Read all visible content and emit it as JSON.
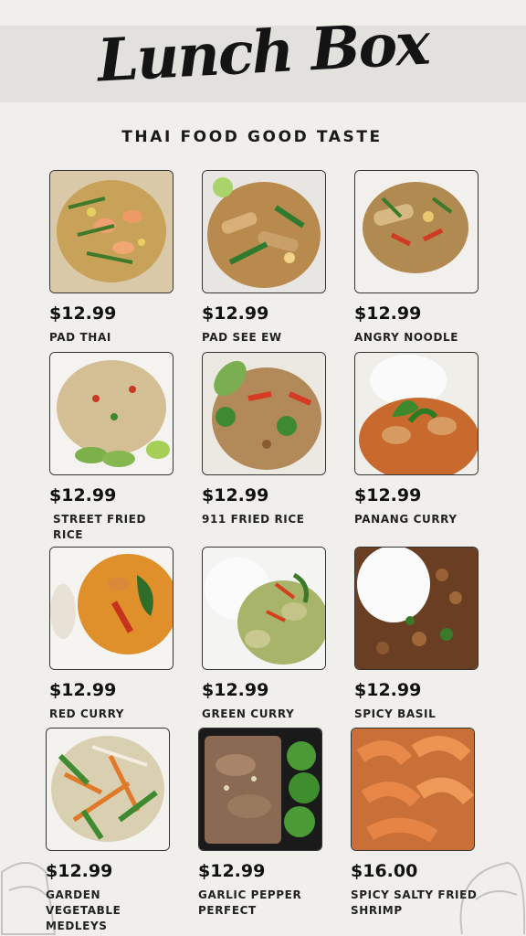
{
  "header": {
    "title": "Lunch Box",
    "tagline": "THAI FOOD GOOD TASTE"
  },
  "menu": [
    {
      "price": "$12.99",
      "name": "PAD THAI",
      "photo": "pad-thai"
    },
    {
      "price": "$12.99",
      "name": "PAD SEE EW",
      "photo": "pad-see-ew"
    },
    {
      "price": "$12.99",
      "name": "ANGRY NOODLE",
      "photo": "angry-noodle"
    },
    {
      "price": "$12.99",
      "name": "STREET FRIED RICE",
      "photo": "street-fried-rice"
    },
    {
      "price": "$12.99",
      "name": "911 FRIED RICE",
      "photo": "911-fried-rice"
    },
    {
      "price": "$12.99",
      "name": "PANANG CURRY",
      "photo": "panang-curry"
    },
    {
      "price": "$12.99",
      "name": "RED CURRY",
      "photo": "red-curry"
    },
    {
      "price": "$12.99",
      "name": "GREEN CURRY",
      "photo": "green-curry"
    },
    {
      "price": "$12.99",
      "name": "SPICY BASIL",
      "photo": "spicy-basil"
    },
    {
      "price": "$12.99",
      "name": "GARDEN VEGETABLE MEDLEYS",
      "photo": "garden-vegetable-medleys"
    },
    {
      "price": "$12.99",
      "name": "GARLIC PEPPER PERFECT",
      "photo": "garlic-pepper-perfect"
    },
    {
      "price": "$16.00",
      "name": "SPICY SALTY FRIED SHRIMP",
      "photo": "spicy-salty-fried-shrimp"
    }
  ]
}
